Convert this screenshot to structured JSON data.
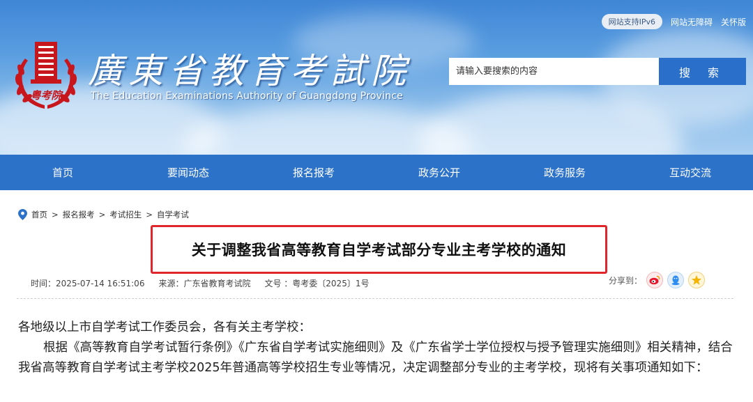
{
  "header": {
    "ipv6_badge": "网站支持IPv6",
    "accessibility_link": "网站无障碍",
    "care_link": "关怀版",
    "site_title": "廣東省教育考試院",
    "site_subtitle": "The Education Examinations Authority of Guangdong Province",
    "emblem_text": "粤考院",
    "search_placeholder": "请输入要搜索的内容",
    "search_button": "搜 索"
  },
  "nav": {
    "items": [
      "首页",
      "要闻动态",
      "报名报考",
      "政务公开",
      "政务服务",
      "互动交流"
    ]
  },
  "breadcrumb": {
    "items": [
      "首页",
      "报名报考",
      "考试招生",
      "自学考试"
    ],
    "separator": ">"
  },
  "article": {
    "title": "关于调整我省高等教育自学考试部分专业主考学校的通知",
    "time": "时间：2025-07-14 16:51:06",
    "source": "来源：广东省教育考试院",
    "doc_no": "文号 ：粤考委〔2025〕1号",
    "share_label": "分享到：",
    "share_icons": [
      "weibo-icon",
      "qq-icon",
      "qzone-icon"
    ],
    "paragraphs": [
      "各地级以上市自学考试工作委员会，各有关主考学校：",
      "根据《高等教育自学考试暂行条例》《广东省自学考试实施细则》及《广东省学士学位授权与授予管理实施细则》相关精神，结合我省高等教育自学考试主考学校2025年普通高等学校招生专业等情况，决定调整部分专业的主考学校，现将有关事项通知如下："
    ]
  },
  "colors": {
    "nav_bg": "#2d72c9",
    "search_button_bg": "#2a6fc9",
    "title_highlight_border": "#e0252b",
    "emblem_red": "#c8161d"
  }
}
